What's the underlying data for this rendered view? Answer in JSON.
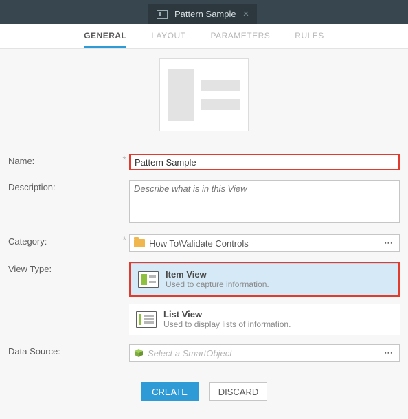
{
  "header": {
    "tab_title": "Pattern Sample"
  },
  "nav": {
    "general": "GENERAL",
    "layout": "LAYOUT",
    "parameters": "PARAMETERS",
    "rules": "RULES"
  },
  "labels": {
    "name": "Name:",
    "description": "Description:",
    "category": "Category:",
    "view_type": "View Type:",
    "data_source": "Data Source:"
  },
  "fields": {
    "name_value": "Pattern Sample",
    "description_placeholder": "Describe what is in this View",
    "category_value": "How To\\Validate Controls",
    "data_source_placeholder": "Select a SmartObject"
  },
  "view_types": {
    "item": {
      "title": "Item View",
      "desc": "Used to capture information."
    },
    "list": {
      "title": "List View",
      "desc": "Used to display lists of information."
    }
  },
  "buttons": {
    "create": "CREATE",
    "discard": "DISCARD"
  }
}
